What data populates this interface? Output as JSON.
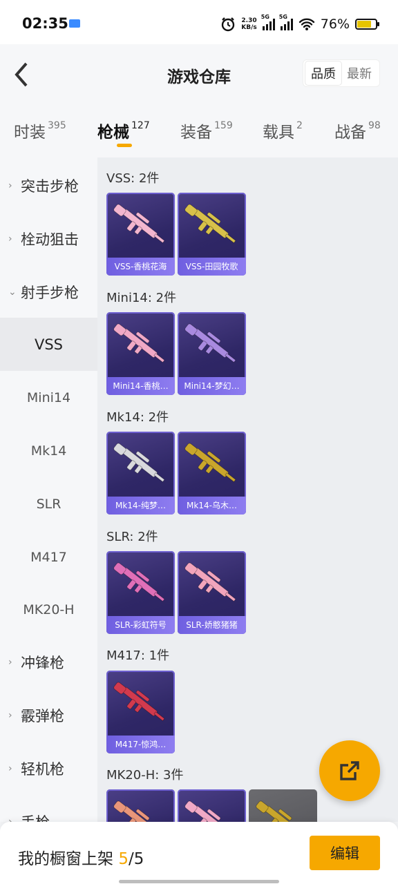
{
  "status_bar": {
    "time": "02:35",
    "net_speed_value": "2.30",
    "net_speed_unit": "KB/s",
    "sim1": "5G",
    "sim2": "5G",
    "battery": "76%"
  },
  "header": {
    "title": "游戏仓库",
    "sort_options": [
      "品质",
      "最新"
    ],
    "sort_active": "品质"
  },
  "category_tabs": [
    {
      "label": "时装",
      "count": "395"
    },
    {
      "label": "枪械",
      "count": "127"
    },
    {
      "label": "装备",
      "count": "159"
    },
    {
      "label": "载具",
      "count": "2"
    },
    {
      "label": "战备",
      "count": "98"
    }
  ],
  "active_tab": "枪械",
  "sidebar": {
    "categories_top": [
      {
        "label": "突击步枪",
        "chevron": "›"
      },
      {
        "label": "栓动狙击",
        "chevron": "›"
      },
      {
        "label": "射手步枪",
        "chevron": "⌄"
      }
    ],
    "subitems": [
      "VSS",
      "Mini14",
      "Mk14",
      "SLR",
      "M417",
      "MK20-H"
    ],
    "active_subitem": "VSS",
    "categories_bottom": [
      {
        "label": "冲锋枪",
        "chevron": "›"
      },
      {
        "label": "霰弹枪",
        "chevron": "›"
      },
      {
        "label": "轻机枪",
        "chevron": "›"
      },
      {
        "label": "手枪",
        "chevron": "›"
      }
    ]
  },
  "groups": [
    {
      "title": "VSS: 2件",
      "items": [
        {
          "name": "VSS-香桃花海",
          "color": "#f3b6cf"
        },
        {
          "name": "VSS-田园牧歌",
          "color": "#d8c14a"
        }
      ]
    },
    {
      "title": "Mini14: 2件",
      "items": [
        {
          "name": "Mini14-香桃…",
          "color": "#f1a9c6"
        },
        {
          "name": "Mini14-梦幻…",
          "color": "#a98ae0"
        }
      ]
    },
    {
      "title": "Mk14: 2件",
      "items": [
        {
          "name": "Mk14-纯梦…",
          "color": "#d9d9dd"
        },
        {
          "name": "Mk14-乌木…",
          "color": "#c9a62c"
        }
      ]
    },
    {
      "title": "SLR: 2件",
      "items": [
        {
          "name": "SLR-彩虹符号",
          "color": "#e06fb8"
        },
        {
          "name": "SLR-娇憨猪猪",
          "color": "#f2a5bc"
        }
      ]
    },
    {
      "title": "M417: 1件",
      "items": [
        {
          "name": "M417-惊鸿…",
          "color": "#d23a4e"
        }
      ]
    },
    {
      "title": "MK20-H: 3件",
      "items": [
        {
          "name": "",
          "color": "#e9967a"
        },
        {
          "name": "",
          "color": "#f1a9c6"
        },
        {
          "name": "",
          "color": "#c9a62c"
        }
      ]
    }
  ],
  "bottom_bar": {
    "text_prefix": "我的橱窗上架 ",
    "listed": "5",
    "separator": "/",
    "capacity": "5",
    "edit_label": "编辑"
  },
  "colors": {
    "accent": "#f6a800",
    "card_bg": "#2f2766",
    "card_caption": "#7b6be6"
  }
}
